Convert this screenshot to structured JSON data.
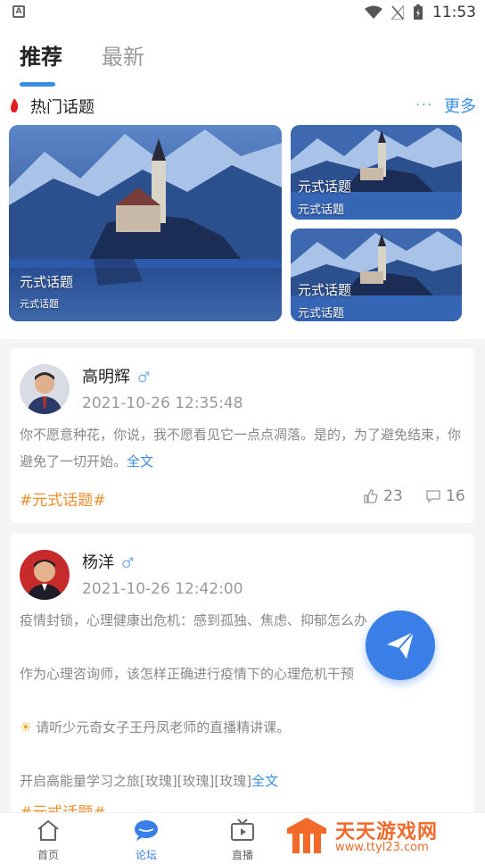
{
  "status": {
    "time": "11:53",
    "left_icon": "A"
  },
  "tabs": [
    {
      "label": "推荐",
      "active": true
    },
    {
      "label": "最新",
      "active": false
    }
  ],
  "hot": {
    "title": "热门话题",
    "more_label": "更多",
    "more_dots": "···"
  },
  "hot_cards": [
    {
      "title": "元式话题",
      "subtitle": "元式话题"
    },
    {
      "title": "元式话题",
      "subtitle": "元式话题"
    },
    {
      "title": "元式话题",
      "subtitle": "元式话题"
    }
  ],
  "posts": [
    {
      "username": "高明辉",
      "gender_icon": "male-icon",
      "time": "2021-10-26 12:35:48",
      "text": "你不愿意种花，你说，我不愿看见它一点点凋落。是的，为了避免结束，你避免了一切开始。",
      "full_label": "全文",
      "topic": "#元式话题#",
      "likes": "23",
      "comments": "16"
    },
    {
      "username": "杨洋",
      "gender_icon": "male-icon",
      "time": "2021-10-26 12:42:00",
      "line1": "疫情封锁，心理健康出危机：感到孤独、焦虑、抑郁怎么办",
      "line2": "作为心理咨询师，该怎样正确进行疫情下的心理危机干预",
      "line3": "请听少元奇女子王丹凤老师的直播精讲课。",
      "line4": "开启高能量学习之旅[玫瑰][玫瑰][玫瑰]",
      "full_label": "全文",
      "topic": "#元式话题#"
    }
  ],
  "nav": [
    {
      "label": "首页"
    },
    {
      "label": "论坛"
    },
    {
      "label": "直播"
    }
  ],
  "watermark": {
    "title": "天天游戏网",
    "url": "www.ttyl23.com"
  },
  "colors": {
    "accent": "#3a8ee6",
    "topic": "#f08c2a"
  }
}
